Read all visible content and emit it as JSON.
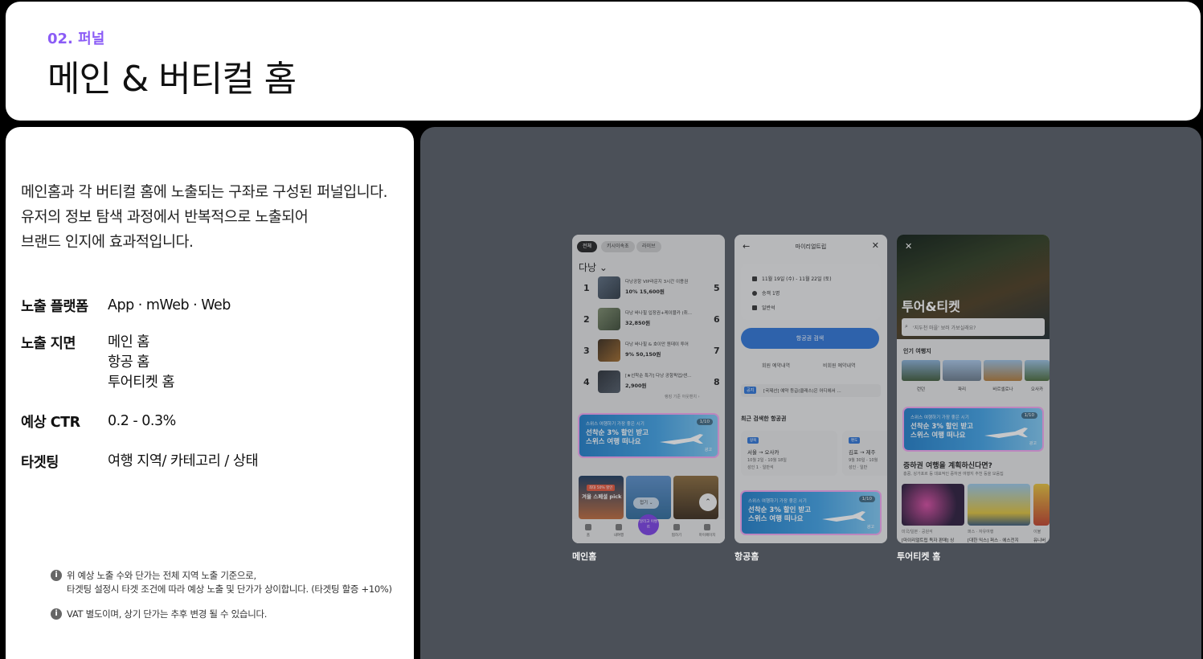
{
  "header": {
    "eyebrow": "02. 퍼널",
    "title": "메인 & 버티컬 홈"
  },
  "intro": [
    "메인홈과 각 버티컬 홈에 노출되는 구좌로 구성된 퍼널입니다.",
    "유저의 정보 탐색 과정에서 반복적으로 노출되어",
    "브랜드 인지에 효과적입니다."
  ],
  "specs": {
    "platform": {
      "label": "노출 플랫폼",
      "value": "App · mWeb · Web"
    },
    "placement": {
      "label": "노출 지면",
      "values": [
        "메인 홈",
        "항공 홈",
        "투어티켓 홈"
      ]
    },
    "ctr": {
      "label": "예상 CTR",
      "value": "0.2 - 0.3%"
    },
    "targeting": {
      "label": "타겟팅",
      "value": "여행 지역/ 카테고리 / 상태"
    }
  },
  "notes": {
    "note1_line1": "위 예상 노출 수와 단가는 전체 지역 노출 기준으로,",
    "note1_line2": "타겟팅 설정시 타겟 조건에 따라 예상 노출 및 단가가 상이합니다. (타겟팅 할증 +10%)",
    "note2": "VAT 별도이며, 상기 단가는 추후 변경 될 수 있습니다."
  },
  "ad": {
    "small": "스위스 여행하기 가장 좋은 시기",
    "headline_line1": "선착순 3% 할인 받고",
    "headline_line2": "스위스 여행 떠나요",
    "counter": "1/10",
    "badge": "광고"
  },
  "phones": {
    "main": {
      "caption": "메인홈",
      "chips": [
        "전체",
        "키시이속초",
        "라이브"
      ],
      "city": "다낭 ⌄",
      "rankings": [
        {
          "left": "1",
          "right": "5",
          "title": "다낭공항 VIP라운지 3시간 이용권",
          "price": "10% 15,600원"
        },
        {
          "left": "2",
          "right": "6",
          "title": "다낭 바나힐 입장권+케이블카 (취...",
          "price": "32,850원"
        },
        {
          "left": "3",
          "right": "7",
          "title": "다낭 바나힐 & 호이안 원데이 투어",
          "price": "9% 50,150원"
        },
        {
          "left": "4",
          "right": "8",
          "title": "[★선착순 특가] 다낭 공항픽업/샌...",
          "price": "2,900원"
        }
      ],
      "more": "랭킹 기준 아웃밴치 ›",
      "photo_tag": "최대 50% 할인",
      "photo_label": "겨울 스페셜 pick",
      "fold": "접기 ⌄",
      "tabs": [
        "홈",
        "내여행",
        "찜하기",
        "마이페이지"
      ],
      "center_tab": "알리고 이벤트"
    },
    "air": {
      "caption": "항공홈",
      "nav_back": "←",
      "nav_title": "마이리얼트립",
      "nav_close": "✕",
      "date": "11월 19일 (수) - 11월 22일 (토)",
      "pax": "승객 1명",
      "cabin": "일반석",
      "search_btn": "항공권 검색",
      "link1": "회원 예약내역",
      "link2": "비회원 예약내역",
      "notice_tag": "공지",
      "notice_text": "[국제선] 예약 등급(클래스)은 어디에서 ...",
      "recent_title": "최근 검색한 항공권",
      "recent1": {
        "tag": "왕복",
        "route": "서울 → 오사카",
        "date": "10월 2일 - 10월 18일",
        "pax": "성인 1 · 일반석"
      },
      "recent2": {
        "tag": "편도",
        "route": "김포 → 제주",
        "date": "9월 30일 - 10월",
        "pax": "성인 · 일반"
      }
    },
    "tour": {
      "caption": "투어티켓 홈",
      "close": "✕",
      "title": "투어&티켓",
      "search": "'지두천 마을' 보러 가보실래요?",
      "popular": "인기 여행지",
      "cities": [
        "런던",
        "파리",
        "바르셀로나",
        "오사카"
      ],
      "question": "증하권 여행을 계획하신다면?",
      "question_sub": "홍콩, 싱가포르 등 대표적인 증하권 여행지 추천 등을 모음집",
      "item1_sub": "미국/일본 · 공원석",
      "item1_title": "[마이리얼트립 독자 판매] 싱",
      "item2_sub": "퍼스 · 자유여행",
      "item2_title": "[대한 익스] 퍼스 · 에스전지",
      "item3_sub": "이불",
      "item3_title": "유니버"
    }
  }
}
